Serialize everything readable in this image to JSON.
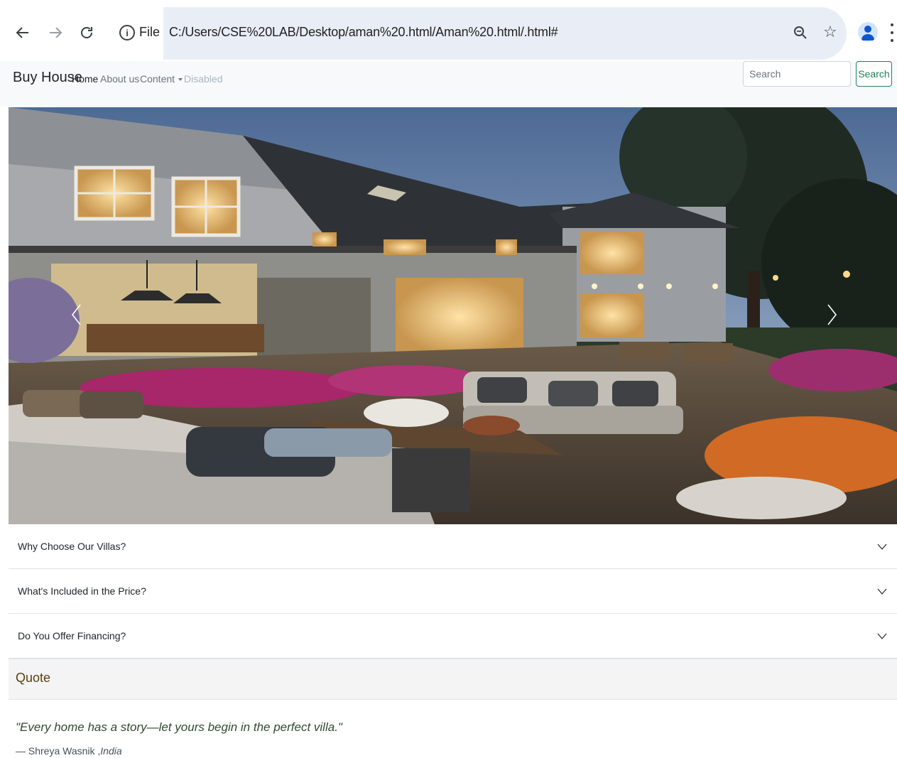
{
  "browser": {
    "back_icon": "arrow-left-icon",
    "forward_icon": "arrow-right-icon",
    "reload_icon": "reload-icon",
    "site_info_label": "File",
    "url": "C:/Users/CSE%20LAB/Desktop/aman%20.html/Aman%20.html/.html#",
    "zoom_icon": "zoom-icon",
    "bookmark_icon": "star-icon",
    "profile_icon": "profile-icon",
    "menu_icon": "kebab-menu-icon"
  },
  "navbar": {
    "brand": "Buy House",
    "links": [
      {
        "label": "Home",
        "state": "active"
      },
      {
        "label": "About us",
        "state": "normal"
      },
      {
        "label": "Content",
        "state": "dropdown"
      },
      {
        "label": "Disabled",
        "state": "disabled"
      }
    ],
    "search_placeholder": "Search",
    "search_button": "Search"
  },
  "carousel": {
    "prev_icon": "chevron-left-icon",
    "next_icon": "chevron-right-icon"
  },
  "accordion": {
    "items": [
      {
        "question": "Why Choose Our Villas?",
        "expanded": false
      },
      {
        "question": "What's Included in the Price?",
        "expanded": false
      },
      {
        "question": "Do You Offer Financing?",
        "expanded": false
      }
    ]
  },
  "quote": {
    "header": "Quote",
    "text": "\"Every home has a story—let yours begin in the perfect villa.\"",
    "author": "— Shreya Wasnik ,",
    "source": "India"
  },
  "colors": {
    "navbar_bg": "#f8f9fa",
    "search_button": "#198754",
    "quote_header_text": "#5a3e12"
  }
}
